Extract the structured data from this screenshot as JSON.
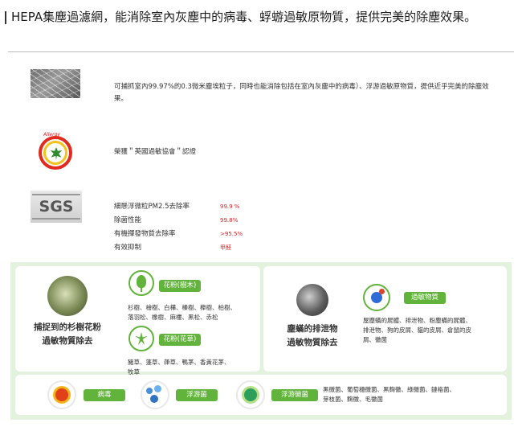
{
  "header": {
    "title": "HEPA集塵過濾網，能消除室內灰塵中的病毒、蜉蝣過敏原物質，提供完美的除塵效果。"
  },
  "features": [
    {
      "icon": "hepa-fiber-image",
      "text": "可捕抓室內99.97%的0.3微米塵埃粒子，同時也能消除包括在室內灰塵中的病毒）、浮游過敏原物質，提供近乎完美的除塵效果。"
    },
    {
      "icon": "allergy-uk-seal-icon",
      "seal_text": "Allergy",
      "text": "榮獲＂英國過敏協會＂認證"
    }
  ],
  "sgs": {
    "logo_text": "SGS",
    "rows": [
      {
        "label": "細懸浮微粒PM2.5去除率",
        "value": "99.9 %"
      },
      {
        "label": "除菌性能",
        "value": "99.8%"
      },
      {
        "label": "有機揮發物質去除率",
        "value": ">95.5%"
      },
      {
        "label": "有效抑制",
        "value": "甲醛"
      }
    ]
  },
  "catch": {
    "title_line1": "捕捉到的杉樹花粉",
    "title_line2": "過敏物質除去",
    "tree_pill": "花粉(樹木)",
    "tree_text_line1": "杉樹、檜樹、白樺、榛樹、櫸樹、柏樹、",
    "tree_text_line2": "落羽松、橡樹、麻樓、黑松、赤松",
    "grass_pill": "花粉(花草)",
    "grass_text_line1": "豬草、蓬草、葎草、鴨茅、香黃花茅、",
    "grass_text_line2": "牧草"
  },
  "mite": {
    "title_line1": "塵蟎的排泄物",
    "title_line2": "過敏物質除去",
    "pill": "過敏物質",
    "text_line1": "屋塵蟎的屍體、排泄物、粉塵蟎的屍體、",
    "text_line2": "排泄物、狗的皮屑、貓的皮屑、倉鼠的皮",
    "text_line3": "屑、黴菌"
  },
  "bottom": {
    "virus_pill": "病毒",
    "bacteria_pill": "浮游菌",
    "mold_pill": "浮游黴菌",
    "mold_text_line1": "黑黴菌、葡萄穗黴菌、黑麴黴、綠黴菌、鏈格菌、",
    "mold_text_line2": "芽枝菌、麴黴、毛黴菌"
  },
  "colors": {
    "accent_green": "#62b33b",
    "panel_bg": "#e2f2dd",
    "value_red": "#dd2222"
  }
}
